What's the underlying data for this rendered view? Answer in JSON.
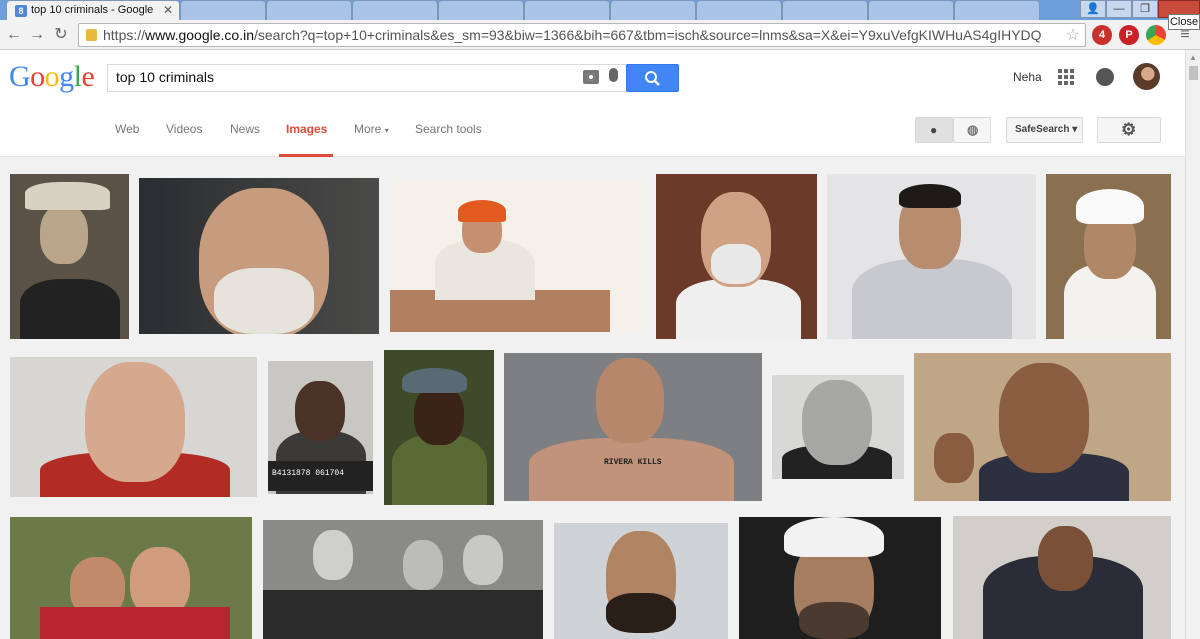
{
  "browser": {
    "active_tab_title": "top 10 criminals - Google",
    "tooltip": "Close",
    "url_prefix": "https://",
    "url_host": "www.google.co.in",
    "url_rest": "/search?q=top+10+criminals&es_sm=93&biw=1366&bih=667&tbm=isch&source=lnms&sa=X&ei=Y9xuVefgKIWHuAS4gIHYDQ",
    "extension_badge": "4"
  },
  "google": {
    "logo": [
      "G",
      "o",
      "o",
      "g",
      "l",
      "e"
    ],
    "logo_colors": [
      "#4285f4",
      "#ea4335",
      "#fbbc05",
      "#4285f4",
      "#34a853",
      "#ea4335"
    ],
    "search_query": "top 10 criminals",
    "user_name": "Neha",
    "safesearch_label": "SafeSearch"
  },
  "tabs": [
    "Web",
    "Videos",
    "News",
    "Images",
    "More",
    "Search tools"
  ],
  "active_tab": "Images",
  "images": [
    {
      "caption": ""
    },
    {
      "caption": ""
    },
    {
      "caption": ""
    },
    {
      "caption": ""
    },
    {
      "caption": ""
    },
    {
      "caption": ""
    },
    {
      "caption": ""
    },
    {
      "caption": "B4131878 061704"
    },
    {
      "caption": ""
    },
    {
      "caption": "RIVERA KILLS"
    },
    {
      "caption": ""
    },
    {
      "caption": ""
    },
    {
      "caption": ""
    },
    {
      "caption": ""
    },
    {
      "caption": ""
    },
    {
      "caption": ""
    },
    {
      "caption": ""
    }
  ]
}
